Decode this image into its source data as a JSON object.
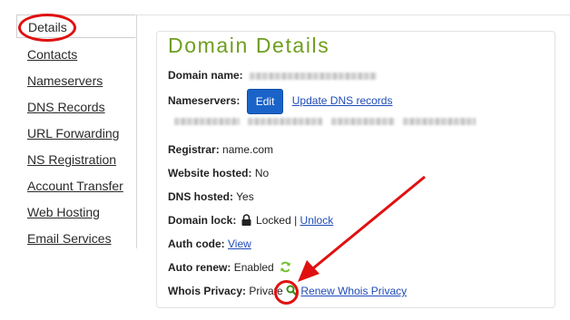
{
  "sidebar": {
    "active_tab": "Details",
    "items": [
      {
        "label": "Contacts"
      },
      {
        "label": "Nameservers"
      },
      {
        "label": "DNS Records"
      },
      {
        "label": "URL Forwarding"
      },
      {
        "label": "NS Registration"
      },
      {
        "label": "Account Transfer"
      },
      {
        "label": "Web Hosting"
      },
      {
        "label": "Email Services"
      }
    ]
  },
  "main": {
    "title": "Domain Details",
    "domain_name_label": "Domain name:",
    "nameservers_label": "Nameservers:",
    "edit_button": "Edit",
    "update_dns_link": "Update DNS records",
    "registrar_label": "Registrar:",
    "registrar_value": "name.com",
    "website_hosted_label": "Website hosted:",
    "website_hosted_value": "No",
    "dns_hosted_label": "DNS hosted:",
    "dns_hosted_value": "Yes",
    "domain_lock_label": "Domain lock:",
    "domain_lock_value": "Locked |",
    "unlock_link": "Unlock",
    "auth_code_label": "Auth code:",
    "view_link": "View",
    "auto_renew_label": "Auto renew:",
    "auto_renew_value": "Enabled",
    "whois_label": "Whois Privacy:",
    "whois_value": "Private",
    "renew_whois_link": "Renew Whois Privacy"
  },
  "colors": {
    "title_green": "#6f9e1f",
    "link_blue": "#1f4bb8",
    "button_blue": "#1a63c9",
    "annotation_red": "#e01010"
  },
  "icons": [
    "lock-icon",
    "refresh-icon",
    "magnifier-icon"
  ]
}
